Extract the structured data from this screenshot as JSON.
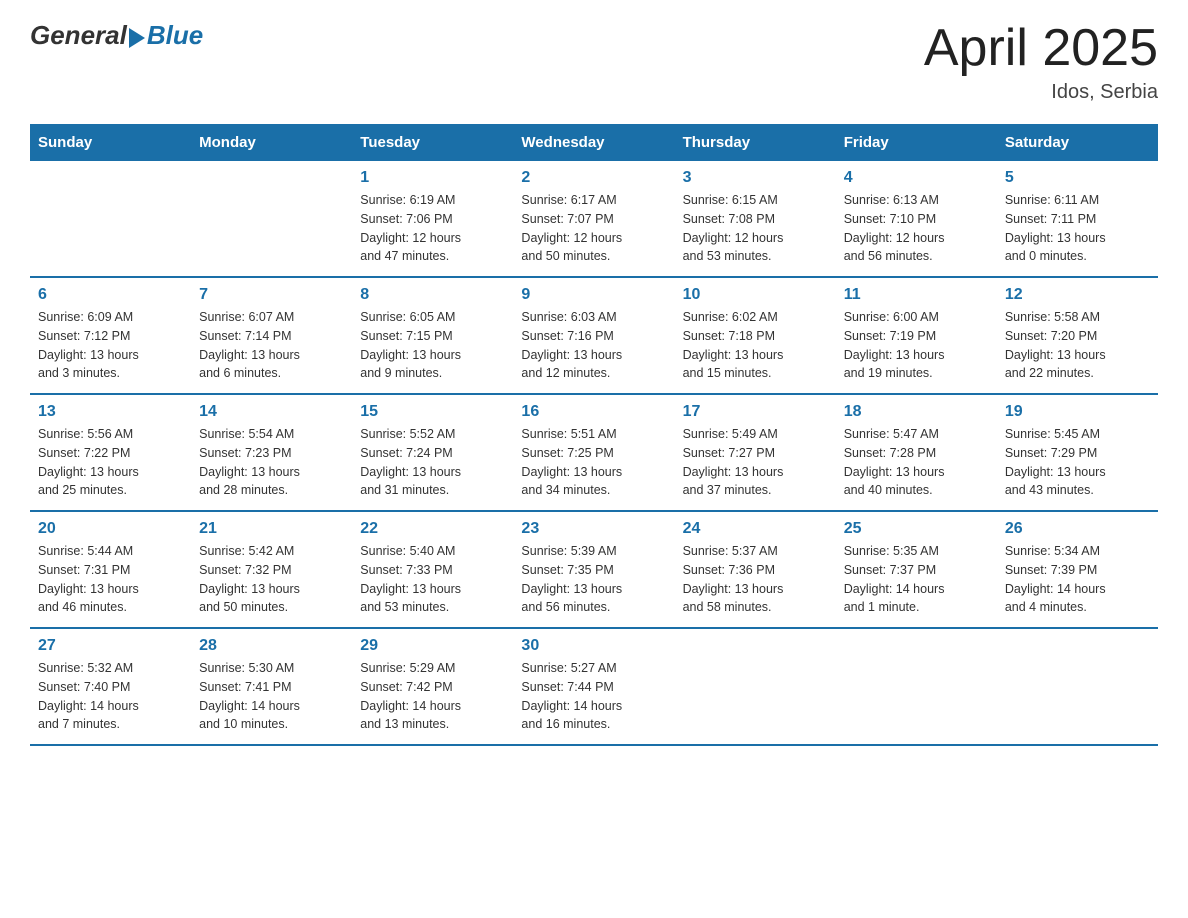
{
  "header": {
    "logo_general": "General",
    "logo_blue": "Blue",
    "title": "April 2025",
    "location": "Idos, Serbia"
  },
  "weekdays": [
    "Sunday",
    "Monday",
    "Tuesday",
    "Wednesday",
    "Thursday",
    "Friday",
    "Saturday"
  ],
  "weeks": [
    [
      {
        "day": "",
        "info": ""
      },
      {
        "day": "",
        "info": ""
      },
      {
        "day": "1",
        "info": "Sunrise: 6:19 AM\nSunset: 7:06 PM\nDaylight: 12 hours\nand 47 minutes."
      },
      {
        "day": "2",
        "info": "Sunrise: 6:17 AM\nSunset: 7:07 PM\nDaylight: 12 hours\nand 50 minutes."
      },
      {
        "day": "3",
        "info": "Sunrise: 6:15 AM\nSunset: 7:08 PM\nDaylight: 12 hours\nand 53 minutes."
      },
      {
        "day": "4",
        "info": "Sunrise: 6:13 AM\nSunset: 7:10 PM\nDaylight: 12 hours\nand 56 minutes."
      },
      {
        "day": "5",
        "info": "Sunrise: 6:11 AM\nSunset: 7:11 PM\nDaylight: 13 hours\nand 0 minutes."
      }
    ],
    [
      {
        "day": "6",
        "info": "Sunrise: 6:09 AM\nSunset: 7:12 PM\nDaylight: 13 hours\nand 3 minutes."
      },
      {
        "day": "7",
        "info": "Sunrise: 6:07 AM\nSunset: 7:14 PM\nDaylight: 13 hours\nand 6 minutes."
      },
      {
        "day": "8",
        "info": "Sunrise: 6:05 AM\nSunset: 7:15 PM\nDaylight: 13 hours\nand 9 minutes."
      },
      {
        "day": "9",
        "info": "Sunrise: 6:03 AM\nSunset: 7:16 PM\nDaylight: 13 hours\nand 12 minutes."
      },
      {
        "day": "10",
        "info": "Sunrise: 6:02 AM\nSunset: 7:18 PM\nDaylight: 13 hours\nand 15 minutes."
      },
      {
        "day": "11",
        "info": "Sunrise: 6:00 AM\nSunset: 7:19 PM\nDaylight: 13 hours\nand 19 minutes."
      },
      {
        "day": "12",
        "info": "Sunrise: 5:58 AM\nSunset: 7:20 PM\nDaylight: 13 hours\nand 22 minutes."
      }
    ],
    [
      {
        "day": "13",
        "info": "Sunrise: 5:56 AM\nSunset: 7:22 PM\nDaylight: 13 hours\nand 25 minutes."
      },
      {
        "day": "14",
        "info": "Sunrise: 5:54 AM\nSunset: 7:23 PM\nDaylight: 13 hours\nand 28 minutes."
      },
      {
        "day": "15",
        "info": "Sunrise: 5:52 AM\nSunset: 7:24 PM\nDaylight: 13 hours\nand 31 minutes."
      },
      {
        "day": "16",
        "info": "Sunrise: 5:51 AM\nSunset: 7:25 PM\nDaylight: 13 hours\nand 34 minutes."
      },
      {
        "day": "17",
        "info": "Sunrise: 5:49 AM\nSunset: 7:27 PM\nDaylight: 13 hours\nand 37 minutes."
      },
      {
        "day": "18",
        "info": "Sunrise: 5:47 AM\nSunset: 7:28 PM\nDaylight: 13 hours\nand 40 minutes."
      },
      {
        "day": "19",
        "info": "Sunrise: 5:45 AM\nSunset: 7:29 PM\nDaylight: 13 hours\nand 43 minutes."
      }
    ],
    [
      {
        "day": "20",
        "info": "Sunrise: 5:44 AM\nSunset: 7:31 PM\nDaylight: 13 hours\nand 46 minutes."
      },
      {
        "day": "21",
        "info": "Sunrise: 5:42 AM\nSunset: 7:32 PM\nDaylight: 13 hours\nand 50 minutes."
      },
      {
        "day": "22",
        "info": "Sunrise: 5:40 AM\nSunset: 7:33 PM\nDaylight: 13 hours\nand 53 minutes."
      },
      {
        "day": "23",
        "info": "Sunrise: 5:39 AM\nSunset: 7:35 PM\nDaylight: 13 hours\nand 56 minutes."
      },
      {
        "day": "24",
        "info": "Sunrise: 5:37 AM\nSunset: 7:36 PM\nDaylight: 13 hours\nand 58 minutes."
      },
      {
        "day": "25",
        "info": "Sunrise: 5:35 AM\nSunset: 7:37 PM\nDaylight: 14 hours\nand 1 minute."
      },
      {
        "day": "26",
        "info": "Sunrise: 5:34 AM\nSunset: 7:39 PM\nDaylight: 14 hours\nand 4 minutes."
      }
    ],
    [
      {
        "day": "27",
        "info": "Sunrise: 5:32 AM\nSunset: 7:40 PM\nDaylight: 14 hours\nand 7 minutes."
      },
      {
        "day": "28",
        "info": "Sunrise: 5:30 AM\nSunset: 7:41 PM\nDaylight: 14 hours\nand 10 minutes."
      },
      {
        "day": "29",
        "info": "Sunrise: 5:29 AM\nSunset: 7:42 PM\nDaylight: 14 hours\nand 13 minutes."
      },
      {
        "day": "30",
        "info": "Sunrise: 5:27 AM\nSunset: 7:44 PM\nDaylight: 14 hours\nand 16 minutes."
      },
      {
        "day": "",
        "info": ""
      },
      {
        "day": "",
        "info": ""
      },
      {
        "day": "",
        "info": ""
      }
    ]
  ]
}
